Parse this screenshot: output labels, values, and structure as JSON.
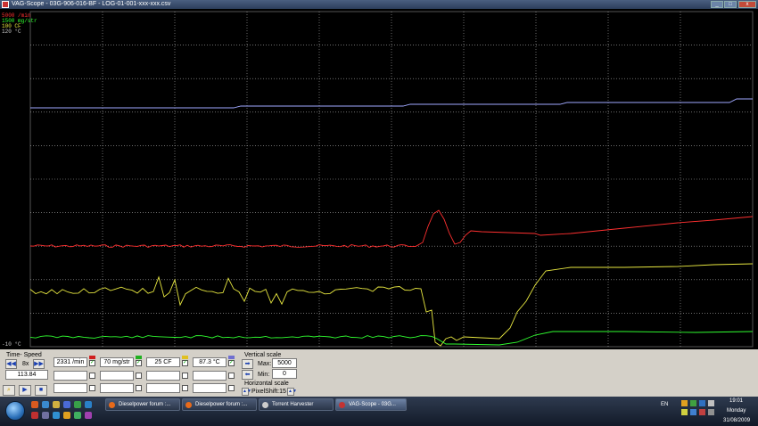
{
  "window": {
    "title": "VAG-Scope  -  03G-906-016-BF  -  LOG-01-001-xxx-xxx.csv",
    "buttons": [
      "_",
      "□",
      "x"
    ]
  },
  "scope": {
    "scale_labels": {
      "rpm": "5000 /min",
      "mgstr": "1500 mg/str",
      "cf": "100 CF",
      "temp_top": "120 °C",
      "temp_bottom": "-10 °C"
    },
    "colors": {
      "rpm": "#ff3030",
      "mgstr": "#30ff30",
      "cf": "#e8e840",
      "temp": "#a0a8ff",
      "grid": "#b0b0b0"
    }
  },
  "controls": {
    "time_speed_label": "Time- Speed",
    "speed_value": "8x",
    "time_value": "113.84",
    "rpm_value": "2331 /min",
    "mgstr_value": "70 mg/str",
    "cf_value": "25 CF",
    "temp_value": "87.3 °C",
    "vertical_scale_label": "Vertical scale",
    "max_label": "Max:",
    "max_value": "5000",
    "min_label": "Min:",
    "min_value": "0",
    "horizontal_scale_label": "Horizontal scale",
    "pixelshift_value": "PixelShift:15",
    "swatch_colors": [
      "#d02020",
      "#20b020",
      "#e0c020",
      "#7070d0"
    ]
  },
  "taskbar": {
    "tasks": [
      {
        "label": "Dieselpower forum :...",
        "icon_color": "#e86a1a"
      },
      {
        "label": "Dieselpower forum :...",
        "icon_color": "#e86a1a"
      },
      {
        "label": "Torrent Harvester",
        "icon_color": "#cccccc"
      },
      {
        "label": "VAG-Scope  -  03G...",
        "icon_color": "#c33333"
      }
    ],
    "language": "EN",
    "clock_time": "19:01",
    "clock_day": "Monday",
    "clock_date": "31/08/2009"
  }
}
